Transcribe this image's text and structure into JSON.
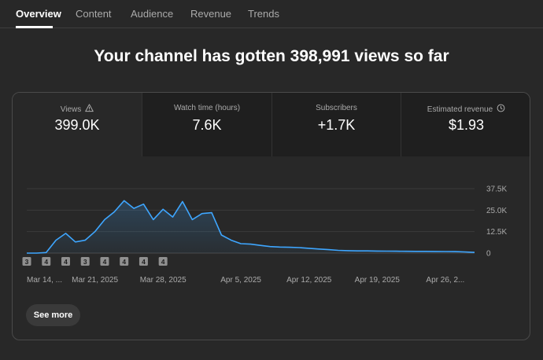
{
  "tabs": [
    {
      "label": "Overview",
      "active": true
    },
    {
      "label": "Content",
      "active": false
    },
    {
      "label": "Audience",
      "active": false
    },
    {
      "label": "Revenue",
      "active": false
    },
    {
      "label": "Trends",
      "active": false
    }
  ],
  "headline": "Your channel has gotten 398,991 views so far",
  "metrics": [
    {
      "label": "Views",
      "value": "399.0K",
      "icon": "warning-icon"
    },
    {
      "label": "Watch time (hours)",
      "value": "7.6K"
    },
    {
      "label": "Subscribers",
      "value": "+1.7K"
    },
    {
      "label": "Estimated revenue",
      "value": "$1.93",
      "icon": "clock-icon"
    }
  ],
  "see_more_label": "See more",
  "chart_data": {
    "type": "area",
    "series_color": "#3ea6ff",
    "y_ticks": [
      {
        "value": 37500,
        "label": "37.5K"
      },
      {
        "value": 25000,
        "label": "25.0K"
      },
      {
        "value": 12500,
        "label": "12.5K"
      },
      {
        "value": 0,
        "label": "0"
      }
    ],
    "ylim": [
      0,
      37500
    ],
    "x_tick_labels": [
      {
        "index": 0,
        "label": "Mar 14, ..."
      },
      {
        "index": 7,
        "label": "Mar 21, 2025"
      },
      {
        "index": 14,
        "label": "Mar 28, 2025"
      },
      {
        "index": 22,
        "label": "Apr 5, 2025"
      },
      {
        "index": 29,
        "label": "Apr 12, 2025"
      },
      {
        "index": 36,
        "label": "Apr 19, 2025"
      },
      {
        "index": 43,
        "label": "Apr 26, 2..."
      }
    ],
    "markers": [
      {
        "index": 0,
        "label": "3"
      },
      {
        "index": 2,
        "label": "4"
      },
      {
        "index": 4,
        "label": "4"
      },
      {
        "index": 6,
        "label": "3"
      },
      {
        "index": 8,
        "label": "4"
      },
      {
        "index": 10,
        "label": "4"
      },
      {
        "index": 12,
        "label": "4"
      },
      {
        "index": 14,
        "label": "4"
      }
    ],
    "values": [
      0,
      0,
      300,
      7500,
      11500,
      6500,
      7500,
      12500,
      19500,
      24000,
      30500,
      26000,
      28500,
      19500,
      25500,
      21000,
      30000,
      19500,
      23000,
      23500,
      10500,
      7500,
      5500,
      5200,
      4500,
      3800,
      3500,
      3400,
      3200,
      2800,
      2400,
      2000,
      1600,
      1400,
      1300,
      1300,
      1200,
      1150,
      1100,
      1050,
      1000,
      1000,
      950,
      900,
      850,
      700,
      400
    ]
  }
}
